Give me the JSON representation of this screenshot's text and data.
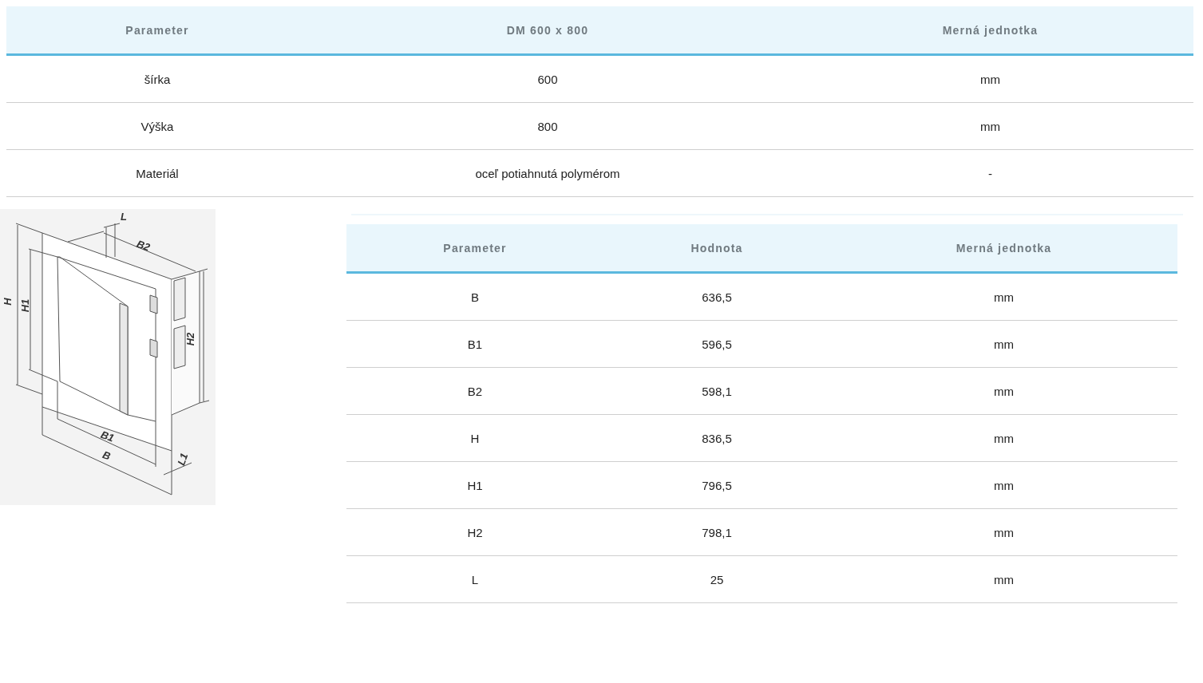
{
  "spec_table": {
    "columns": [
      "Parameter",
      "DM 600 x 800",
      "Merná jednotka"
    ],
    "rows": [
      [
        "šírka",
        "600",
        "mm"
      ],
      [
        "Výška",
        "800",
        "mm"
      ],
      [
        "Materiál",
        "oceľ potiahnutá polymérom",
        "-"
      ]
    ]
  },
  "drawing": {
    "labels": [
      "L",
      "B2",
      "H",
      "H1",
      "H2",
      "B1",
      "B",
      "L1"
    ]
  },
  "dimensions_table": {
    "columns": [
      "Parameter",
      "Hodnota",
      "Merná jednotka"
    ],
    "rows": [
      [
        "B",
        "636,5",
        "mm"
      ],
      [
        "B1",
        "596,5",
        "mm"
      ],
      [
        "B2",
        "598,1",
        "mm"
      ],
      [
        "H",
        "836,5",
        "mm"
      ],
      [
        "H1",
        "796,5",
        "mm"
      ],
      [
        "H2",
        "798,1",
        "mm"
      ],
      [
        "L",
        "25",
        "mm"
      ]
    ]
  }
}
